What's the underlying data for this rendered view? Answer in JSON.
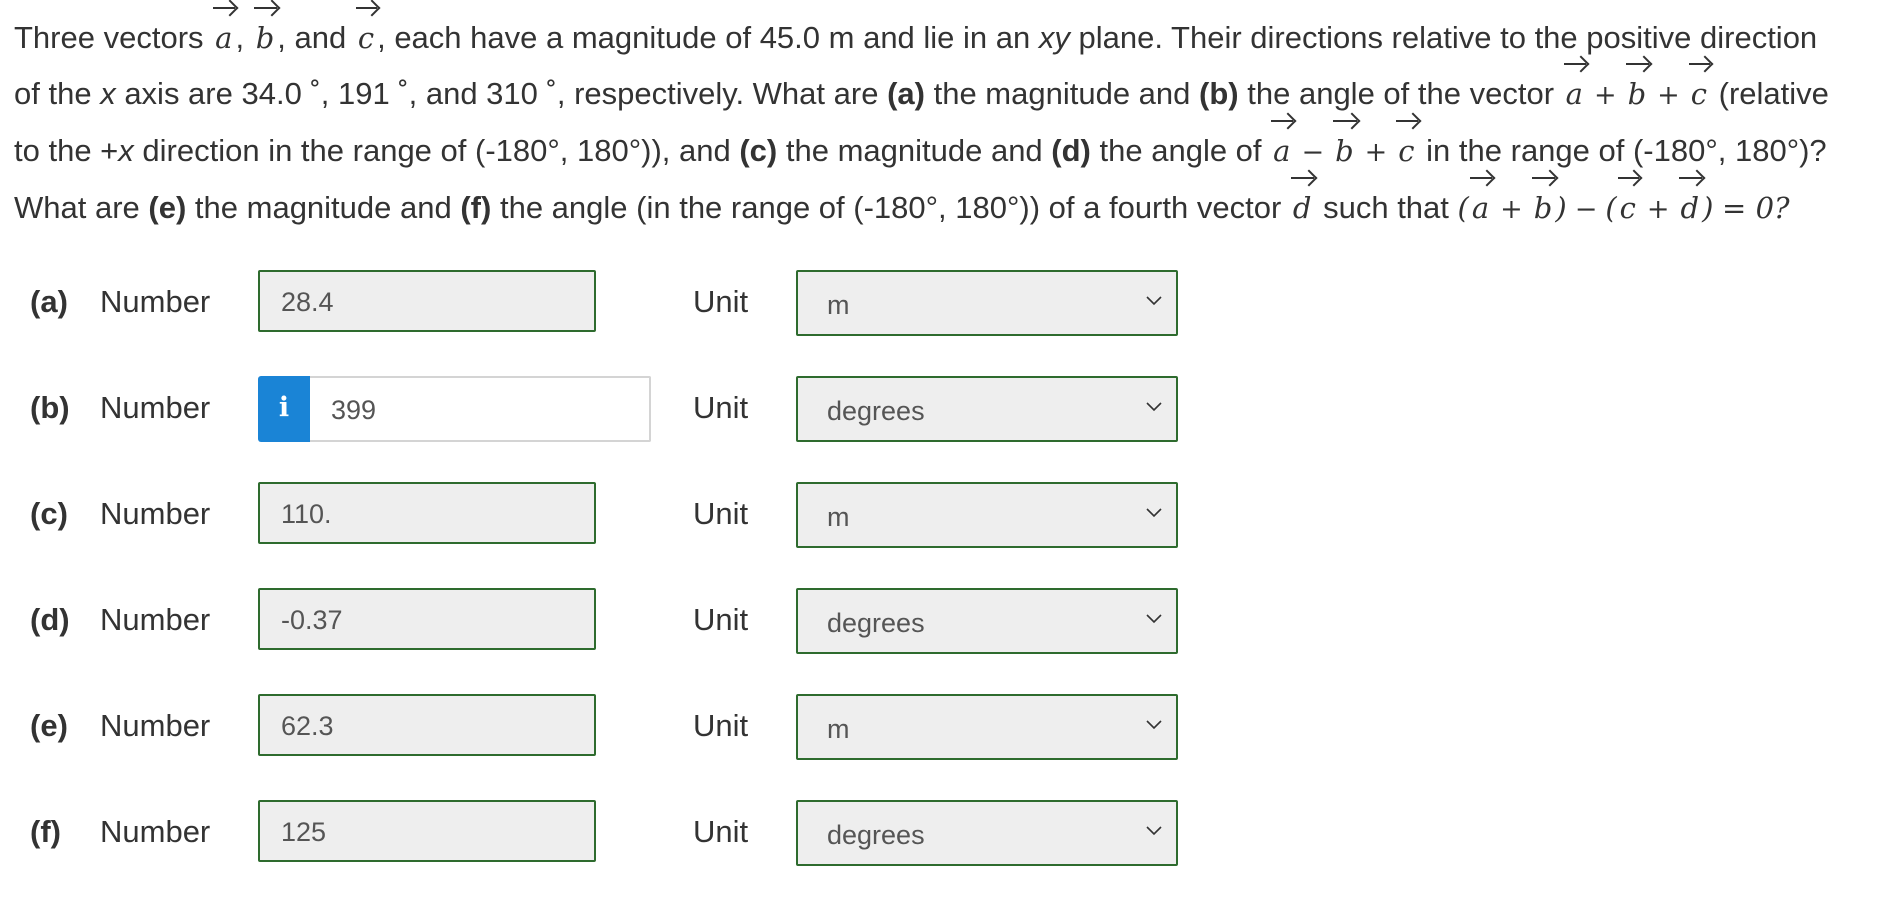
{
  "question": {
    "line1_a": "Three vectors",
    "line1_sep1": ",",
    "line1_and": ", and",
    "line1_b": ", each have a magnitude of 45.0 m and lie in an",
    "line1_xy": "xy",
    "line1_c": "plane. Their directions relative to the positive direction",
    "line2_a": "of the",
    "line2_x": "x",
    "line2_b": "axis are 34.0 ˚, 191 ˚, and 310 ˚, respectively. What are",
    "line2_pa": "(a)",
    "line2_c": "the magnitude and",
    "line2_pb": "(b)",
    "line2_d": "the angle of the vector",
    "line2_e": "(relative",
    "line3_a": "to the +",
    "line3_x": "x",
    "line3_b": "direction in the range of (-180°, 180°)), and",
    "line3_pc": "(c)",
    "line3_c": "the magnitude and",
    "line3_pd": "(d)",
    "line3_d": "the angle of",
    "line3_e": "in the range of (-180°, 180°)?",
    "line4_a": "What are",
    "line4_pe": "(e)",
    "line4_b": "the magnitude and",
    "line4_pf": "(f)",
    "line4_c": "the angle (in the range of (-180°, 180°)) of a fourth vector",
    "line4_d": "such that",
    "line4_eq": "= 0?",
    "vec_a": "a",
    "vec_b": "b",
    "vec_c": "c",
    "vec_d": "d",
    "plus": "+",
    "minus": "−",
    "lparen": "(",
    "rparen": ")"
  },
  "answers": [
    {
      "part": "(a)",
      "label": "Number",
      "value": "28.4",
      "unit_label": "Unit",
      "unit": "m"
    },
    {
      "part": "(b)",
      "label": "Number",
      "value": "399",
      "unit_label": "Unit",
      "unit": "degrees",
      "info_icon": "i"
    },
    {
      "part": "(c)",
      "label": "Number",
      "value": "110.",
      "unit_label": "Unit",
      "unit": "m"
    },
    {
      "part": "(d)",
      "label": "Number",
      "value": "-0.37",
      "unit_label": "Unit",
      "unit": "degrees"
    },
    {
      "part": "(e)",
      "label": "Number",
      "value": "62.3",
      "unit_label": "Unit",
      "unit": "m"
    },
    {
      "part": "(f)",
      "label": "Number",
      "value": "125",
      "unit_label": "Unit",
      "unit": "degrees"
    }
  ],
  "colors": {
    "correct_border": "#2e6b2e",
    "info_button": "#1a84d6",
    "field_bg": "#eeeeee"
  },
  "icons": {
    "info": "info-icon",
    "chevron": "chevron-down-icon"
  }
}
